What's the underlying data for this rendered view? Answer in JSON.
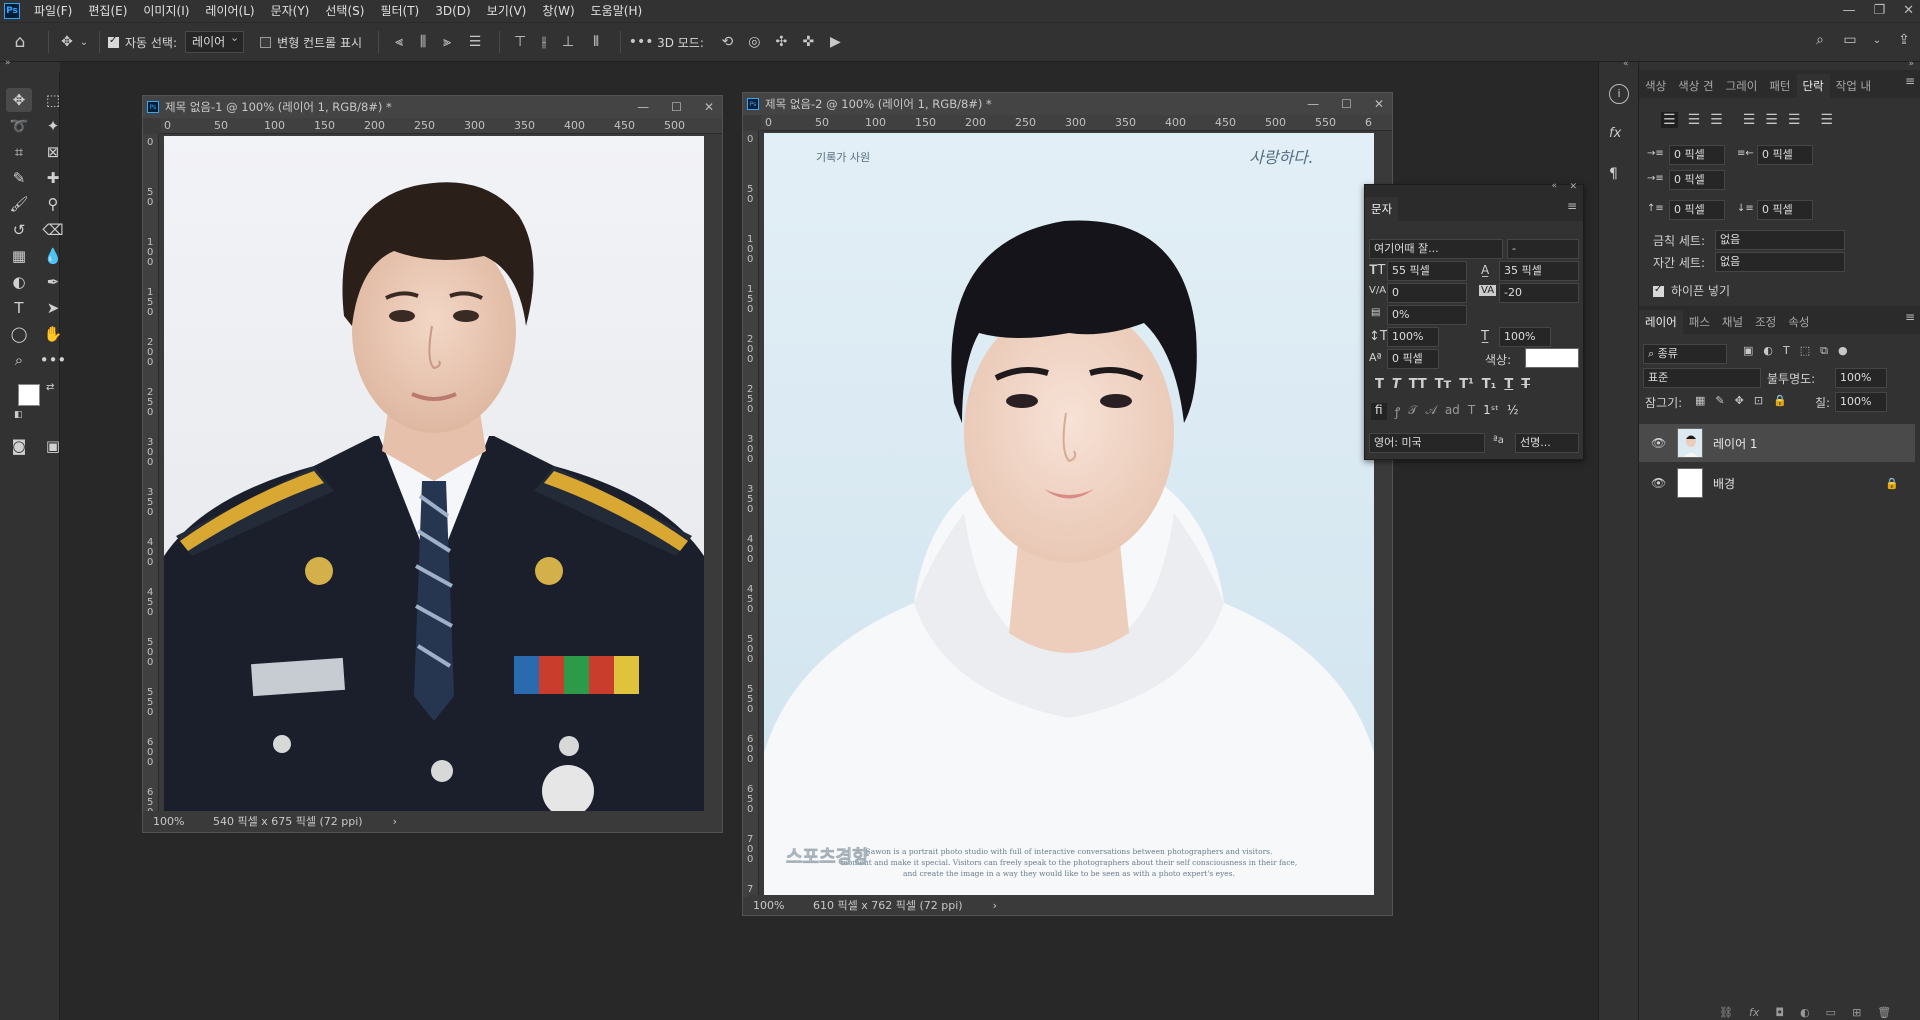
{
  "menubar": {
    "items": [
      "파일(F)",
      "편집(E)",
      "이미지(I)",
      "레이어(L)",
      "문자(Y)",
      "선택(S)",
      "필터(T)",
      "3D(D)",
      "보기(V)",
      "창(W)",
      "도움말(H)"
    ]
  },
  "options": {
    "auto_select_label": "자동 선택:",
    "auto_select_value": "레이어",
    "transform_label": "변형 컨트롤 표시",
    "mode_3d_label": "3D 모드:"
  },
  "doc1": {
    "title": "제목 없음-1 @ 100% (레이어 1, RGB/8#) *",
    "zoom": "100%",
    "info": "540 픽셀 x 675 픽셀 (72 ppi)",
    "ruler_h": [
      "0",
      "50",
      "100",
      "150",
      "200",
      "250",
      "300",
      "350",
      "400",
      "450",
      "500"
    ],
    "ruler_v": [
      "0",
      "5\n0",
      "1\n0\n0",
      "1\n5\n0",
      "2\n0\n0",
      "2\n5\n0",
      "3\n0\n0",
      "3\n5\n0",
      "4\n0\n0",
      "4\n5\n0",
      "5\n0\n0",
      "5\n5\n0",
      "6\n0\n0",
      "6\n5\n0"
    ]
  },
  "doc2": {
    "title": "제목 없음-2 @ 100% (레이어 1, RGB/8#) *",
    "zoom": "100%",
    "info": "610 픽셀 x 762 픽셀 (72 ppi)",
    "ruler_h": [
      "0",
      "50",
      "100",
      "150",
      "200",
      "250",
      "300",
      "350",
      "400",
      "450",
      "500",
      "550",
      "6"
    ],
    "ruler_v": [
      "0",
      "5\n0",
      "1\n0\n0",
      "1\n5\n0",
      "2\n0\n0",
      "2\n5\n0",
      "3\n0\n0",
      "3\n5\n0",
      "4\n0\n0",
      "4\n5\n0",
      "5\n0\n0",
      "5\n5\n0",
      "6\n0\n0",
      "6\n5\n0",
      "7\n0\n0",
      "7"
    ],
    "sign_left": "기록가 사원",
    "sign_right": "사랑하다.",
    "caption_line1": "Sawon is a portrait photo studio with full of interactive conversations between photographers and visitors.",
    "caption_line2": "moment and make it special. Visitors can freely speak to the photographers about their self consciousness in their face,",
    "caption_line3": "and create the image in a way they would like to be seen as with a photo expert's eyes.",
    "watermark": "스포츠경향"
  },
  "char_panel": {
    "title": "문자",
    "font_family": "여기어때 잘...",
    "font_style": "-",
    "size": "55 픽셀",
    "leading": "35 픽셀",
    "kerning": "0",
    "tracking": "-20",
    "scale_pct": "0%",
    "vscale": "100%",
    "hscale": "100%",
    "baseline": "0 픽셀",
    "color_label": "색상:",
    "color": "#ffffff",
    "language": "영어: 미국",
    "antialias": "선명..."
  },
  "para_panel": {
    "tabs": [
      "색상",
      "색상 견",
      "그레이",
      "패턴",
      "단락",
      "작업 내"
    ],
    "active_tab": 4,
    "indent_left": "0 픽셀",
    "indent_right": "0 픽셀",
    "indent_first": "0 픽셀",
    "space_before": "0 픽셀",
    "space_after": "0 픽셀",
    "kinsoku_label": "금칙 세트:",
    "kinsoku_value": "없음",
    "mojikumi_label": "자간 세트:",
    "mojikumi_value": "없음",
    "hyphenate_label": "하이픈 넣기"
  },
  "layers_panel": {
    "tabs": [
      "레이어",
      "패스",
      "채널",
      "조정",
      "속성"
    ],
    "active_tab": 0,
    "filter_kind": "종류",
    "blend_mode": "표준",
    "opacity_label": "불투명도:",
    "opacity": "100%",
    "lock_label": "잠그기:",
    "fill_label": "칠:",
    "fill": "100%",
    "layers": [
      {
        "name": "레이어 1",
        "selected": true
      },
      {
        "name": "배경",
        "selected": false
      }
    ]
  }
}
